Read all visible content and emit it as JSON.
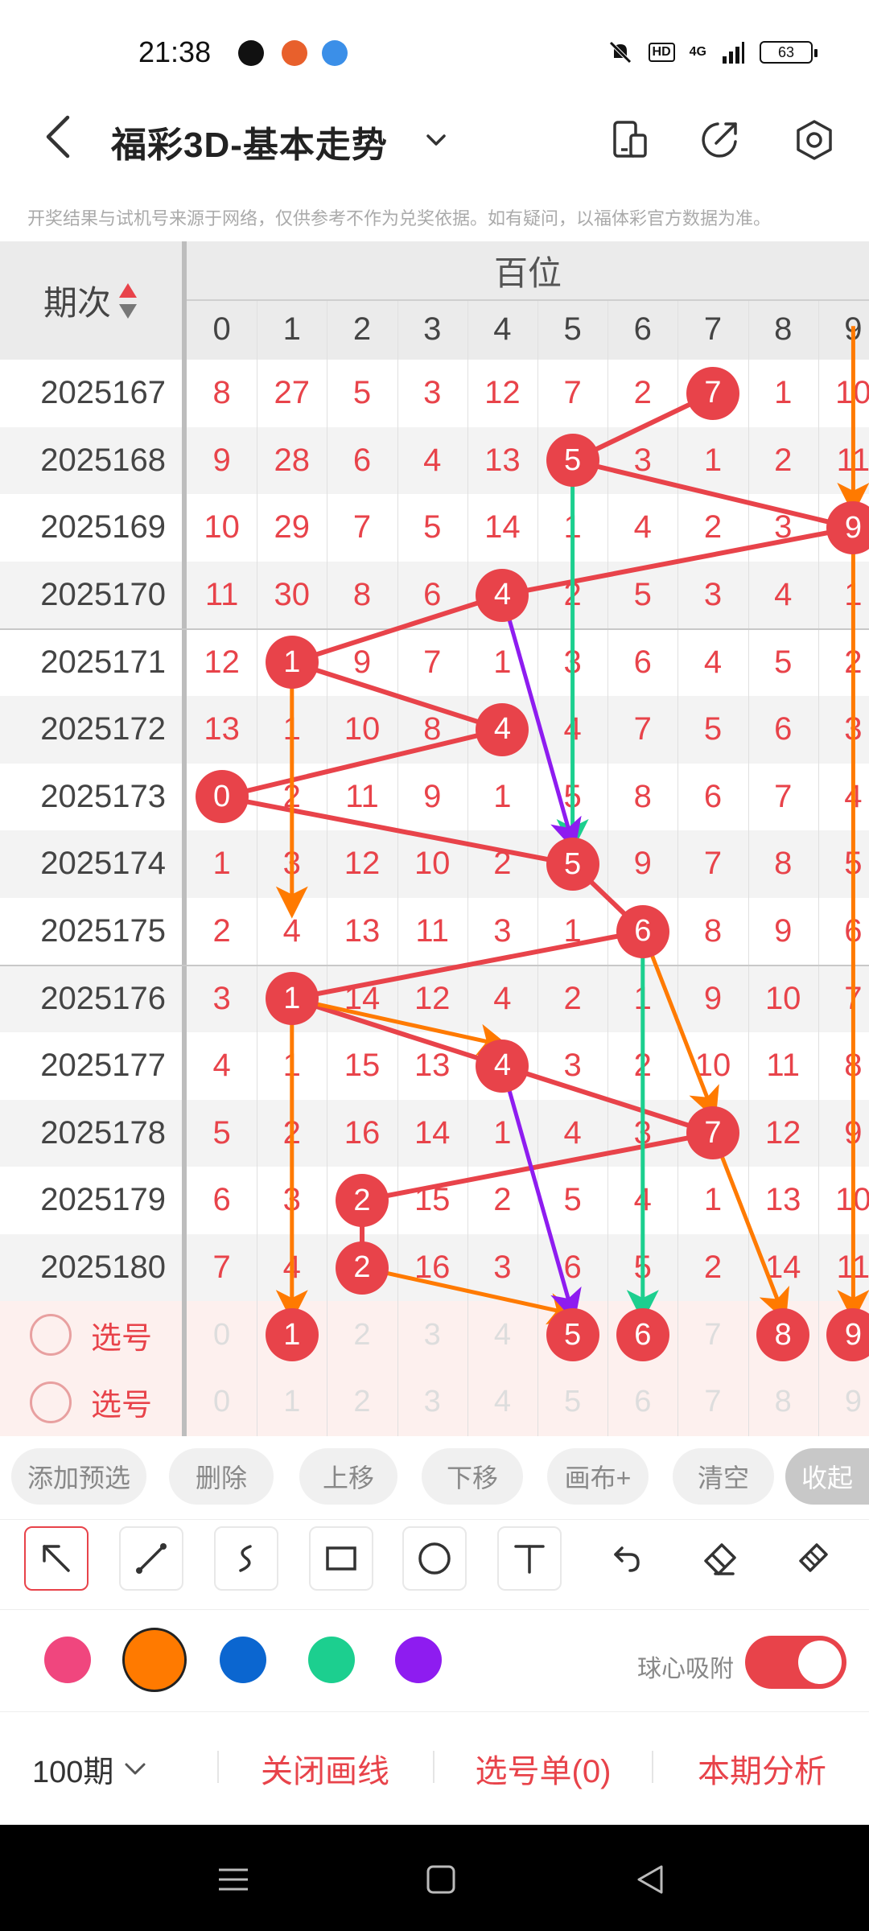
{
  "status_bar": {
    "time": "21:38",
    "hd": "HD",
    "network": "4G",
    "battery": "63"
  },
  "header": {
    "title": "福彩3D-基本走势",
    "icons": [
      "back-icon",
      "chevron-down-icon",
      "phone-chart-icon",
      "share-icon",
      "settings-icon"
    ]
  },
  "disclaimer": "开奖结果与试机号来源于网络，仅供参考不作为兑奖依据。如有疑问，以福体彩官方数据为准。",
  "table": {
    "period_header": "期次",
    "section_header": "百位",
    "columns": [
      "0",
      "1",
      "2",
      "3",
      "4",
      "5",
      "6",
      "7",
      "8",
      "9"
    ],
    "rows": [
      {
        "period": "2025167",
        "cells": [
          "8",
          "27",
          "5",
          "3",
          "12",
          "7",
          "2",
          "7",
          "1",
          "10"
        ],
        "hit": 7
      },
      {
        "period": "2025168",
        "cells": [
          "9",
          "28",
          "6",
          "4",
          "13",
          "5",
          "3",
          "1",
          "2",
          "11"
        ],
        "hit": 5
      },
      {
        "period": "2025169",
        "cells": [
          "10",
          "29",
          "7",
          "5",
          "14",
          "1",
          "4",
          "2",
          "3",
          "9"
        ],
        "hit": 9
      },
      {
        "period": "2025170",
        "cells": [
          "11",
          "30",
          "8",
          "6",
          "4",
          "2",
          "5",
          "3",
          "4",
          "1"
        ],
        "hit": 4
      },
      {
        "period": "2025171",
        "cells": [
          "12",
          "1",
          "9",
          "7",
          "1",
          "3",
          "6",
          "4",
          "5",
          "2"
        ],
        "hit": 1
      },
      {
        "period": "2025172",
        "cells": [
          "13",
          "1",
          "10",
          "8",
          "4",
          "4",
          "7",
          "5",
          "6",
          "3"
        ],
        "hit": 4
      },
      {
        "period": "2025173",
        "cells": [
          "0",
          "2",
          "11",
          "9",
          "1",
          "5",
          "8",
          "6",
          "7",
          "4"
        ],
        "hit": 0
      },
      {
        "period": "2025174",
        "cells": [
          "1",
          "3",
          "12",
          "10",
          "2",
          "5",
          "9",
          "7",
          "8",
          "5"
        ],
        "hit": 5
      },
      {
        "period": "2025175",
        "cells": [
          "2",
          "4",
          "13",
          "11",
          "3",
          "1",
          "6",
          "8",
          "9",
          "6"
        ],
        "hit": 6
      },
      {
        "period": "2025176",
        "cells": [
          "3",
          "1",
          "14",
          "12",
          "4",
          "2",
          "1",
          "9",
          "10",
          "7"
        ],
        "hit": 1
      },
      {
        "period": "2025177",
        "cells": [
          "4",
          "1",
          "15",
          "13",
          "4",
          "3",
          "2",
          "10",
          "11",
          "8"
        ],
        "hit": 4
      },
      {
        "period": "2025178",
        "cells": [
          "5",
          "2",
          "16",
          "14",
          "1",
          "4",
          "3",
          "7",
          "12",
          "9"
        ],
        "hit": 7
      },
      {
        "period": "2025179",
        "cells": [
          "6",
          "3",
          "2",
          "15",
          "2",
          "5",
          "4",
          "1",
          "13",
          "10"
        ],
        "hit": 2
      },
      {
        "period": "2025180",
        "cells": [
          "7",
          "4",
          "2",
          "16",
          "3",
          "6",
          "5",
          "2",
          "14",
          "11"
        ],
        "hit": 2
      }
    ],
    "selection_rows": [
      {
        "label": "选号",
        "cells": [
          "0",
          "1",
          "2",
          "3",
          "4",
          "5",
          "6",
          "7",
          "8",
          "9"
        ],
        "selected": [
          1,
          5,
          6,
          8,
          9
        ]
      },
      {
        "label": "选号",
        "cells": [
          "0",
          "1",
          "2",
          "3",
          "4",
          "5",
          "6",
          "7",
          "8",
          "9"
        ],
        "selected": []
      }
    ]
  },
  "drawing_colors": {
    "red": "#e8434a",
    "orange": "#ff7a00",
    "green": "#1ccf8f",
    "purple": "#8e1cf0"
  },
  "action_buttons": [
    "添加预选",
    "删除",
    "上移",
    "下移",
    "画布+",
    "清空",
    "收起"
  ],
  "tools": [
    "select-arrow-icon",
    "line-icon",
    "curve-icon",
    "rectangle-icon",
    "circle-icon",
    "text-icon",
    "undo-icon",
    "eraser-icon",
    "brush-icon"
  ],
  "palette": {
    "colors": [
      "#f0467e",
      "#ff7a00",
      "#0b66d0",
      "#1ccf8f",
      "#8e1cf0"
    ],
    "selected_index": 1,
    "snap_label": "球心吸附",
    "snap_on": true
  },
  "bottom_bar": {
    "period_select": "100期",
    "close_lines": "关闭画线",
    "selection_list": "选号单(0)",
    "analysis": "本期分析"
  }
}
